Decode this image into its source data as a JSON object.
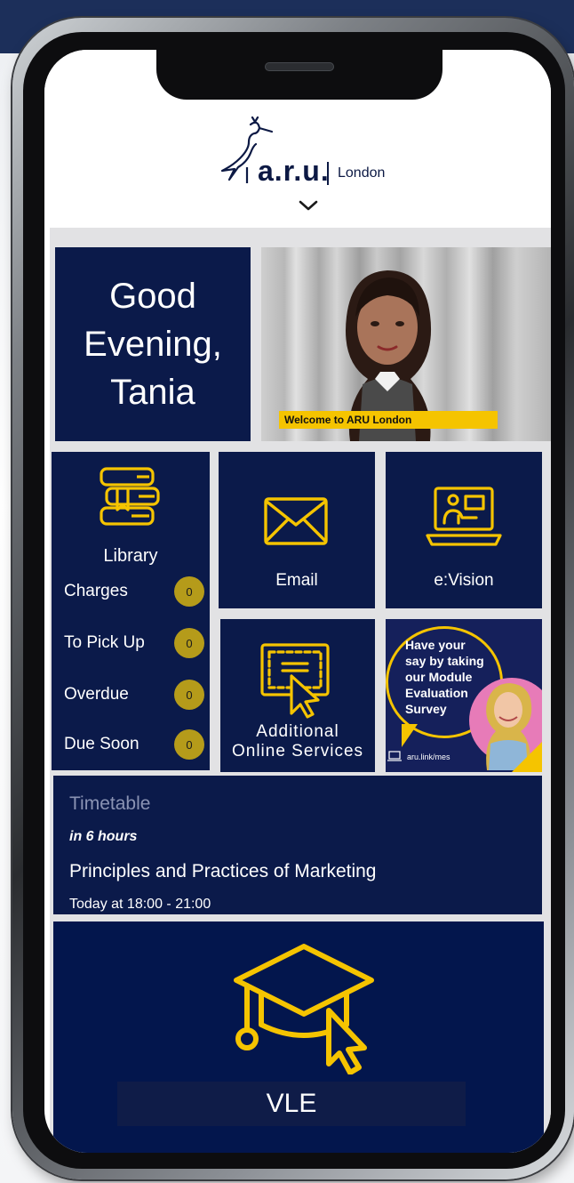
{
  "header": {
    "logo_text": "a.r.u.",
    "logo_sub": "London"
  },
  "greeting": {
    "line1": "Good",
    "line2": "Evening,",
    "line3": "Tania"
  },
  "banner": {
    "caption": "Welcome to ARU London"
  },
  "library": {
    "title": "Library",
    "rows": [
      {
        "label": "Charges",
        "count": "0"
      },
      {
        "label": "To Pick Up",
        "count": "0"
      },
      {
        "label": "Overdue",
        "count": "0"
      },
      {
        "label": "Due Soon",
        "count": "0"
      }
    ]
  },
  "tiles": {
    "email": "Email",
    "evision": "e:Vision",
    "additional_line1": "Additional",
    "additional_line2": "Online Services"
  },
  "survey": {
    "line1": "Have your",
    "line2": "say by taking",
    "line3": "our Module",
    "line4": "Evaluation",
    "line5": "Survey",
    "link": "aru.link/mes"
  },
  "timetable": {
    "heading": "Timetable",
    "when": "in 6 hours",
    "title": "Principles and Practices of Marketing",
    "time": "Today at 18:00 - 21:00"
  },
  "vle": {
    "label": "VLE"
  },
  "colors": {
    "navy": "#0b1a4a",
    "accent_yellow": "#f5c400",
    "badge_gold": "#b59b1a"
  }
}
